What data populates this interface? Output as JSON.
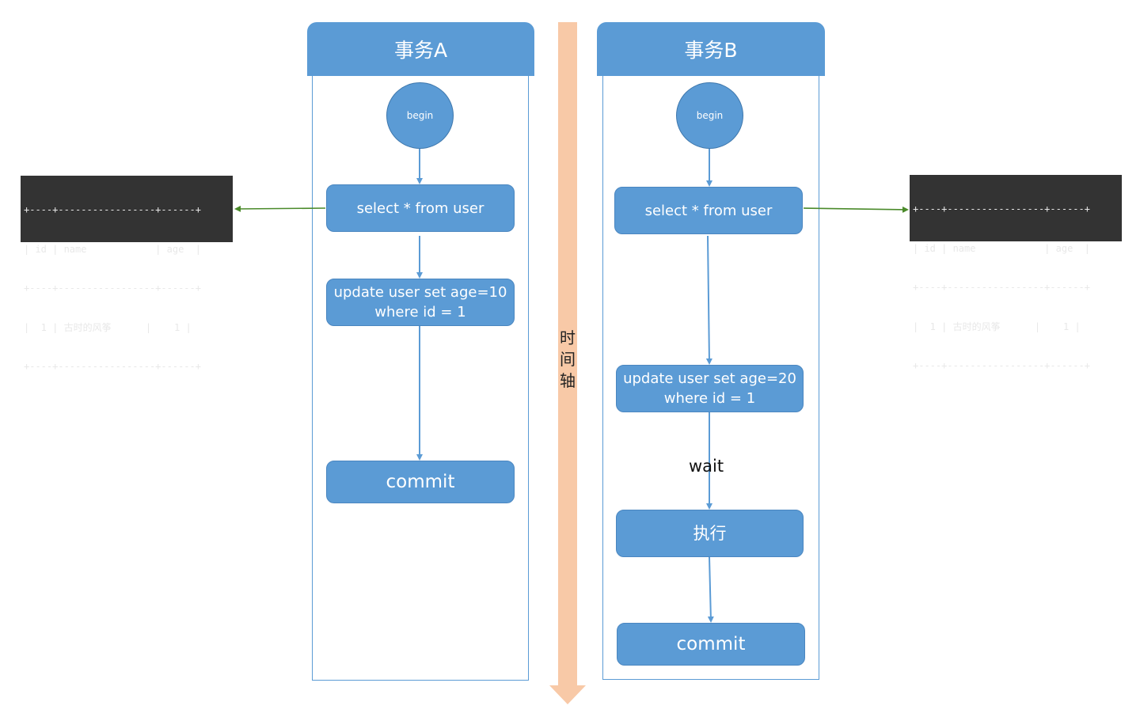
{
  "timeline": {
    "label_chars": [
      "时",
      "间",
      "轴"
    ],
    "color": "#f8c9a7"
  },
  "colors": {
    "node_fill": "#5b9bd5",
    "arrow": "#5b9bd5",
    "query_arrow": "#4a8a2a",
    "terminal_bg": "#333333"
  },
  "transaction_a": {
    "title": "事务A",
    "begin": "begin",
    "steps": [
      {
        "label": "select * from user"
      },
      {
        "label_line1": "update user set age=10",
        "label_line2": "where id = 1"
      },
      {
        "label": "commit"
      }
    ]
  },
  "transaction_b": {
    "title": "事务B",
    "begin": "begin",
    "steps": [
      {
        "label": "select * from user"
      },
      {
        "label_line1": "update user set age=20",
        "label_line2": "where id = 1"
      },
      {
        "label": "执行"
      },
      {
        "label": "commit"
      }
    ],
    "wait_label": "wait"
  },
  "result_left": {
    "lines": [
      "+----+-----------------+------+",
      "| id | name            | age  |",
      "+----+-----------------+------+",
      "|  1 | 古时的风筝      |    1 |",
      "+----+-----------------+------+"
    ],
    "columns": [
      "id",
      "name",
      "age"
    ],
    "rows": [
      [
        "1",
        "古时的风筝",
        "1"
      ]
    ]
  },
  "result_right": {
    "lines": [
      "+----+-----------------+------+",
      "| id | name            | age  |",
      "+----+-----------------+------+",
      "|  1 | 古时的风筝      |    1 |",
      "+----+-----------------+------+"
    ],
    "columns": [
      "id",
      "name",
      "age"
    ],
    "rows": [
      [
        "1",
        "古时的风筝",
        "1"
      ]
    ]
  }
}
